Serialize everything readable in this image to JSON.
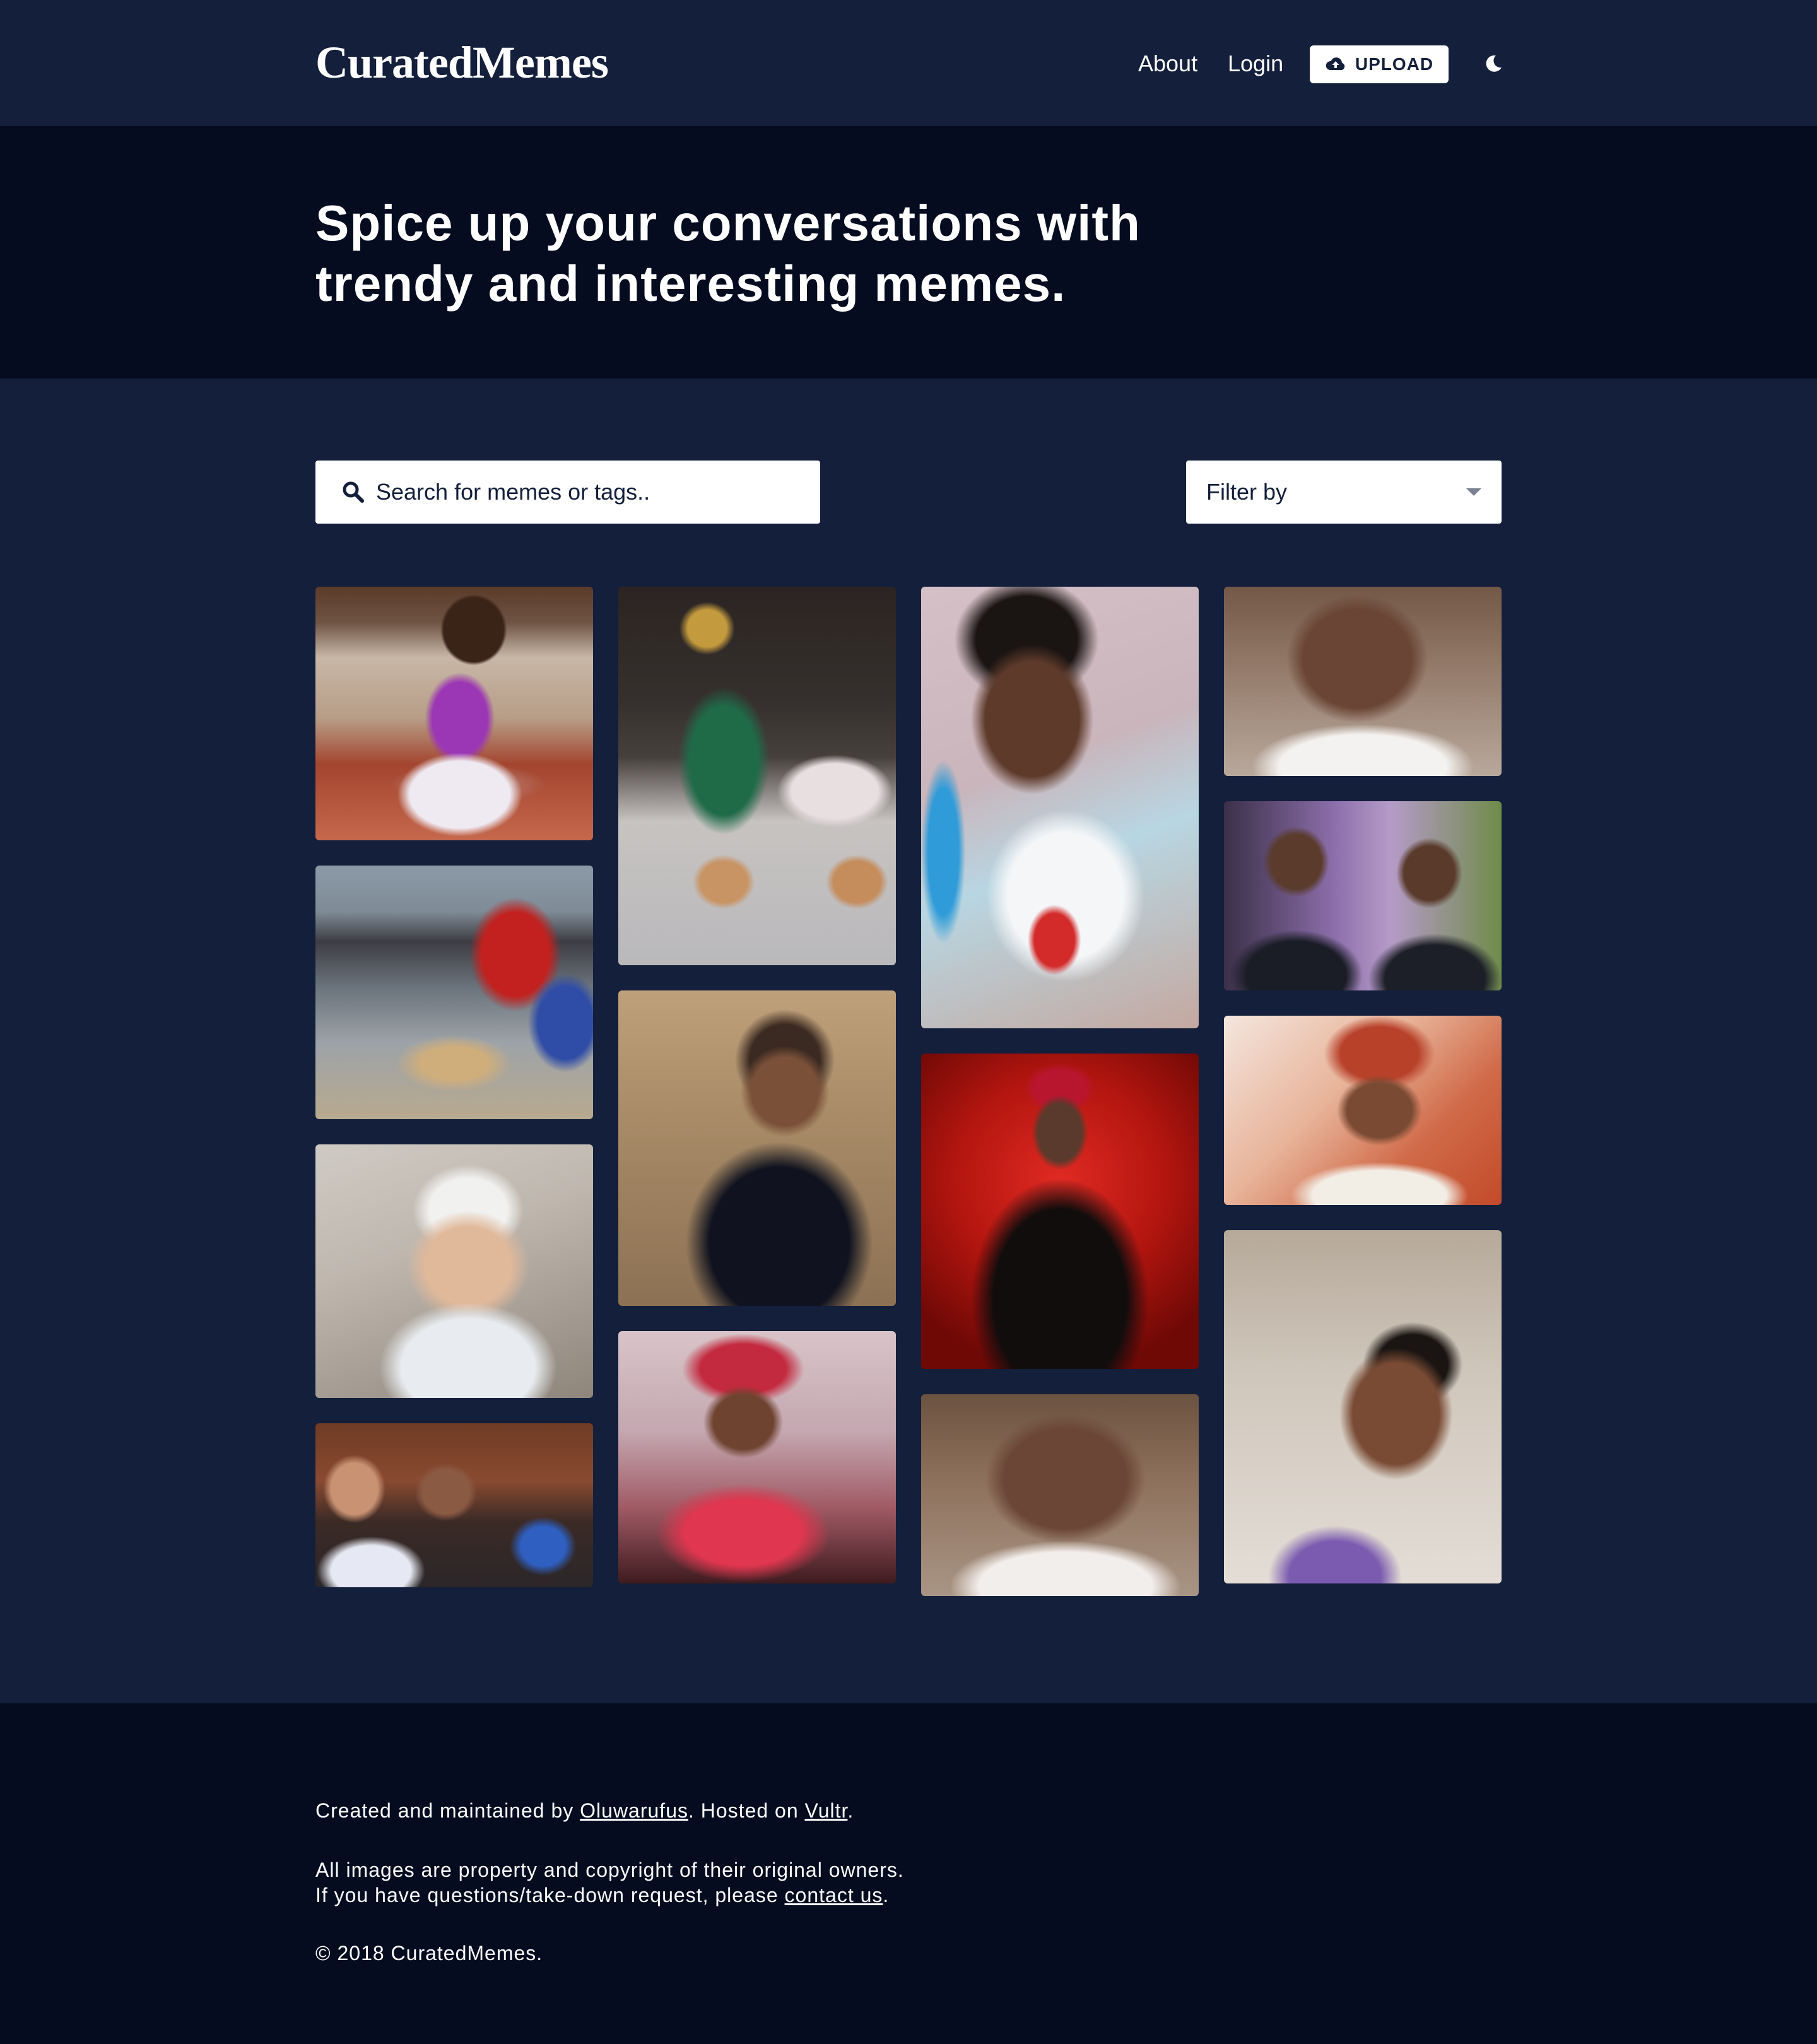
{
  "header": {
    "logo": "CuratedMemes",
    "nav": {
      "about": "About",
      "login": "Login"
    },
    "upload_label": "UPLOAD",
    "theme_icon": "moon-icon"
  },
  "hero": {
    "title_line1": "Spice up your conversations with",
    "title_line2": "trendy and interesting memes."
  },
  "search": {
    "placeholder": "Search for memes or tags.."
  },
  "filter": {
    "label": "Filter by"
  },
  "memes": [
    {
      "name": "meme-laughing-baby"
    },
    {
      "name": "meme-people-at-table"
    },
    {
      "name": "meme-baby-white-hat"
    },
    {
      "name": "meme-shocked-women"
    },
    {
      "name": "meme-man-on-bed"
    },
    {
      "name": "meme-shouting-man"
    },
    {
      "name": "meme-woman-red-beret"
    },
    {
      "name": "meme-smiling-toddler"
    },
    {
      "name": "meme-man-red-cap"
    },
    {
      "name": "meme-crying-man-2"
    },
    {
      "name": "meme-crying-man"
    },
    {
      "name": "meme-thinking-men"
    },
    {
      "name": "meme-man-embroidered-cap"
    },
    {
      "name": "meme-boy-looking-up"
    }
  ],
  "footer": {
    "credit_prefix": "Created and maintained by ",
    "credit_author": "Oluwarufus",
    "credit_middle": ". Hosted on ",
    "credit_host": "Vultr",
    "credit_suffix": ".",
    "copyright_line1": "All images are property and copyright of their original owners.",
    "copyright_line2_prefix": "If you have questions/take-down request, please ",
    "copyright_line2_link": "contact us",
    "copyright_line2_suffix": ".",
    "copyright": "© 2018 CuratedMemes."
  }
}
